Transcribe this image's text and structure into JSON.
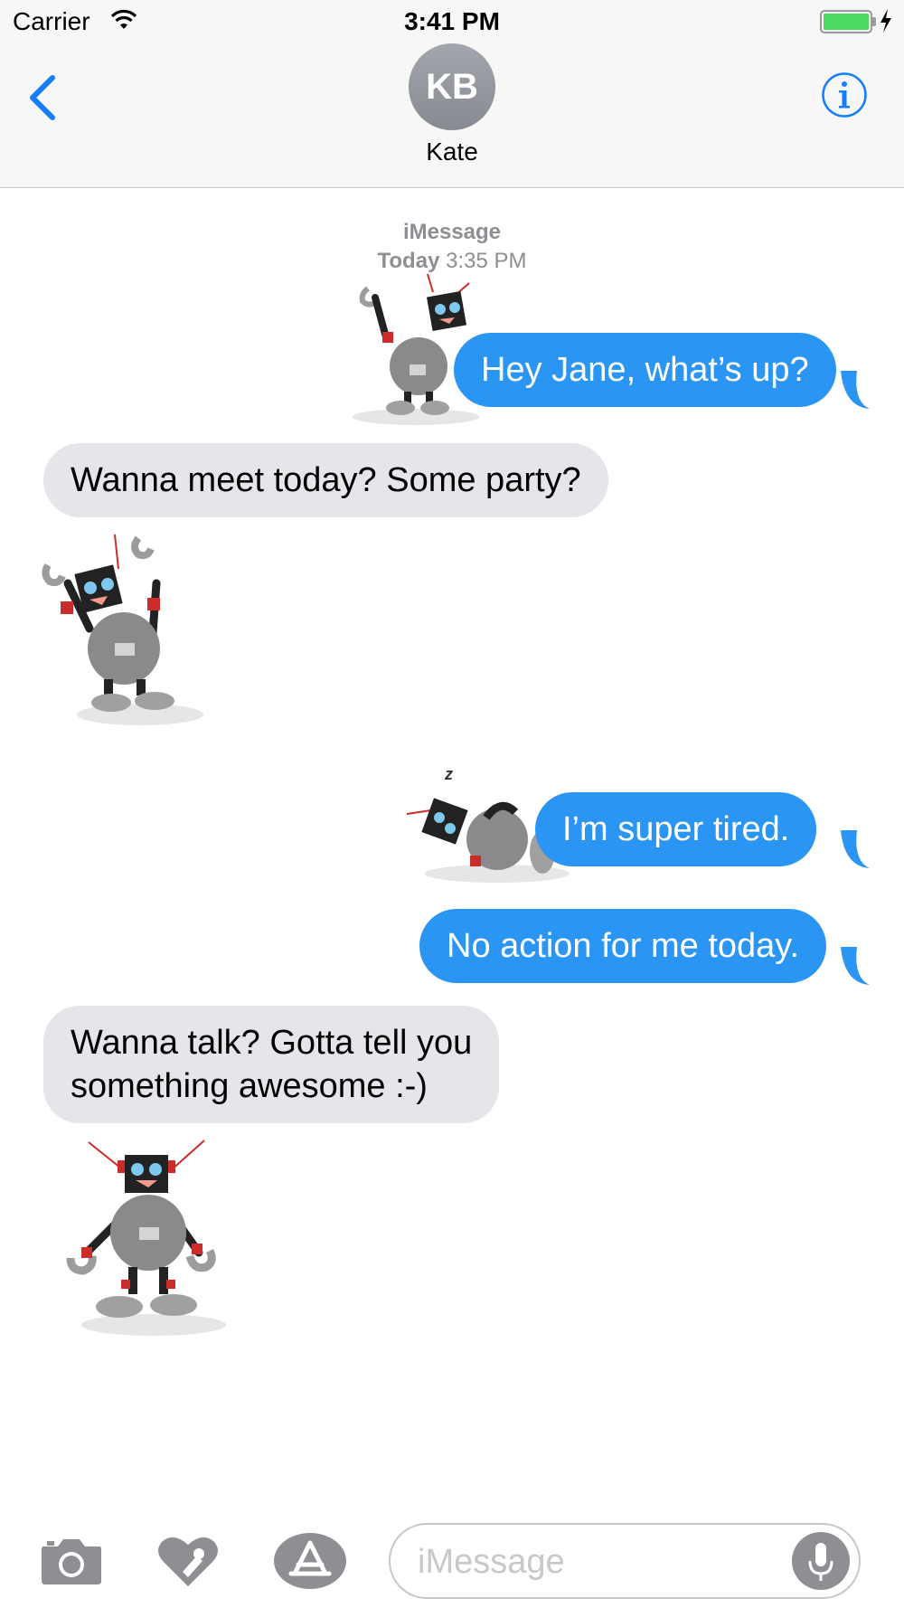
{
  "status_bar": {
    "carrier": "Carrier",
    "time": "3:41 PM",
    "battery_color": "#4cd964"
  },
  "header": {
    "avatar_initials": "KB",
    "contact_name": "Kate",
    "back_icon": "chevron-left-icon",
    "info_icon": "info-icon",
    "accent_color": "#157efb"
  },
  "conversation": {
    "service": "iMessage",
    "day": "Today",
    "time": "3:35 PM",
    "messages": [
      {
        "direction": "outgoing",
        "text": "Hey Jane, what’s up?",
        "sticker": "robot-waving-sticker"
      },
      {
        "direction": "incoming",
        "text": "Wanna meet today? Some party?"
      },
      {
        "direction": "incoming",
        "sticker": "robot-dancing-sticker"
      },
      {
        "direction": "outgoing",
        "text": "I’m super tired.",
        "sticker": "robot-sleeping-sticker",
        "sticker_caption": "z"
      },
      {
        "direction": "outgoing",
        "text": "No action for me today."
      },
      {
        "direction": "incoming",
        "lines": [
          "Wanna talk? Gotta tell you",
          "something awesome :-)"
        ]
      },
      {
        "direction": "incoming",
        "sticker": "robot-standing-sticker"
      }
    ],
    "outgoing_color": "#2b95f4",
    "incoming_color": "#e5e5ea"
  },
  "input_bar": {
    "placeholder": "iMessage",
    "icons": [
      "camera-icon",
      "digital-touch-icon",
      "app-store-icon",
      "microphone-icon"
    ]
  }
}
